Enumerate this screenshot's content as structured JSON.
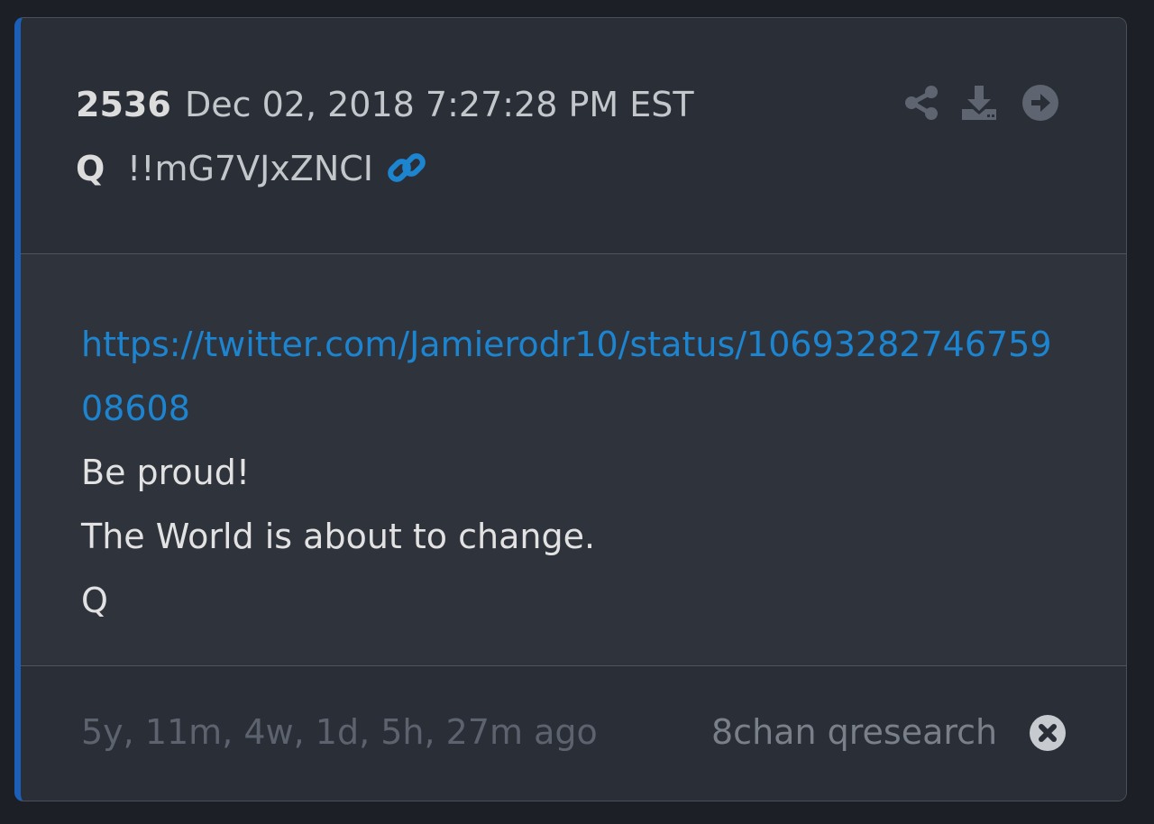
{
  "post": {
    "number": "2536",
    "timestamp": "Dec 02, 2018 7:27:28 PM EST",
    "author": "Q",
    "tripcode": "!!mG7VJxZNCI"
  },
  "body": {
    "link": "https://twitter.com/Jamierodr10/status/1069328274675908608",
    "lines": [
      "Be proud!",
      "The World is about to change.",
      "Q"
    ]
  },
  "footer": {
    "time_ago": "5y, 11m, 4w, 1d, 5h, 27m ago",
    "source": "8chan qresearch"
  },
  "icons": {
    "header_actions": [
      "share-icon",
      "download-icon",
      "arrow-right-circle-icon"
    ],
    "author_link": "link-icon",
    "footer_action": "close-circle-icon"
  },
  "colors": {
    "accent_border": "#1c5fb8",
    "link": "#1d84cf",
    "background": "#2a2e36",
    "body_background": "#2f333c"
  }
}
